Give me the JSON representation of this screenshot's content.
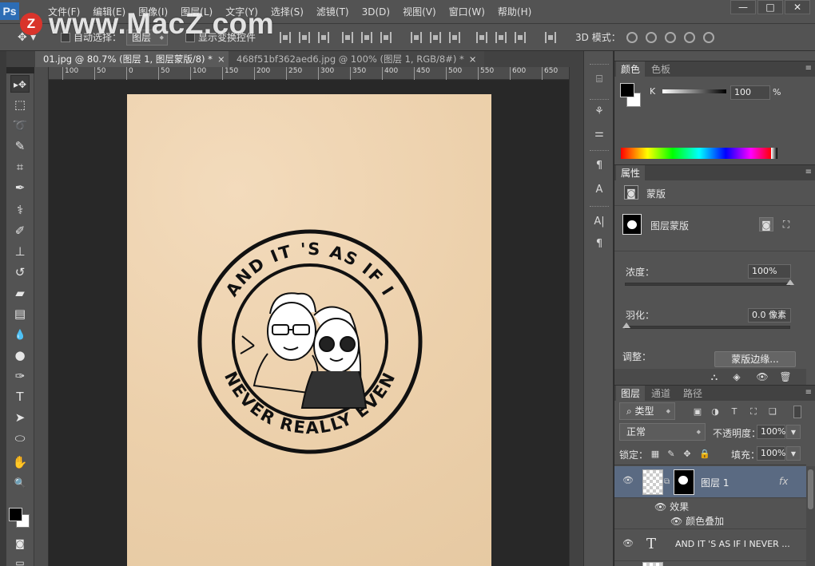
{
  "app": {
    "logo_text": "Ps",
    "watermark_text": "www.MacZ.com",
    "watermark_badge": "Z"
  },
  "menu": [
    "文件(F)",
    "编辑(E)",
    "图像(I)",
    "图层(L)",
    "文字(Y)",
    "选择(S)",
    "滤镜(T)",
    "3D(D)",
    "视图(V)",
    "窗口(W)",
    "帮助(H)"
  ],
  "window_controls": {
    "minimize": "—",
    "maximize": "□",
    "close": "✕"
  },
  "options": {
    "auto_select_label": "自动选择：",
    "auto_select_target": "图层",
    "show_transform_label": "显示变换控件",
    "mode_3d_label": "3D 模式："
  },
  "tabs": [
    {
      "label": "01.jpg @ 80.7% (图层 1, 图层蒙版/8) *",
      "close": "×"
    },
    {
      "label": "468f51bf362aed6.jpg @ 100% (图层 1, RGB/8#) *",
      "close": "×"
    }
  ],
  "ruler_ticks": [
    "100",
    "50",
    "0",
    "50",
    "100",
    "150",
    "200",
    "250",
    "300",
    "350",
    "400",
    "450",
    "500",
    "550",
    "600",
    "650"
  ],
  "tools": [
    {
      "name": "move-tool",
      "glyph": "▸✥"
    },
    {
      "name": "marquee-tool",
      "glyph": "⬚"
    },
    {
      "name": "lasso-tool",
      "glyph": "➰"
    },
    {
      "name": "quick-select-tool",
      "glyph": "✎"
    },
    {
      "name": "crop-tool",
      "glyph": "⌗"
    },
    {
      "name": "eyedropper-tool",
      "glyph": "✒"
    },
    {
      "name": "healing-tool",
      "glyph": "⚕"
    },
    {
      "name": "brush-tool",
      "glyph": "✐"
    },
    {
      "name": "stamp-tool",
      "glyph": "⊥"
    },
    {
      "name": "history-brush-tool",
      "glyph": "↺"
    },
    {
      "name": "eraser-tool",
      "glyph": "▰"
    },
    {
      "name": "gradient-tool",
      "glyph": "▤"
    },
    {
      "name": "blur-tool",
      "glyph": "💧"
    },
    {
      "name": "dodge-tool",
      "glyph": "●"
    },
    {
      "name": "pen-tool",
      "glyph": "✑"
    },
    {
      "name": "type-tool",
      "glyph": "T"
    },
    {
      "name": "path-select-tool",
      "glyph": "➤"
    },
    {
      "name": "shape-tool",
      "glyph": "⬭"
    },
    {
      "name": "hand-tool",
      "glyph": "✋"
    },
    {
      "name": "zoom-tool",
      "glyph": "🔍"
    }
  ],
  "stamp": {
    "top_text": "AND IT 'S AS IF I",
    "bottom_text": "NEVER REALLY EVEN"
  },
  "color_panel": {
    "tab_active": "颜色",
    "tab_inactive": "色板",
    "channel_label": "K",
    "channel_value": "100",
    "channel_unit": "%"
  },
  "properties_panel": {
    "tab": "属性",
    "section_label": "蒙版",
    "mask_label": "图层蒙版",
    "density_label": "浓度：",
    "density_value": "100%",
    "feather_label": "羽化：",
    "feather_value": "0.0 像素",
    "adjust_label": "调整：",
    "refine_button": "蒙版边缘..."
  },
  "layers_panel": {
    "tabs": [
      "图层",
      "通道",
      "路径"
    ],
    "filter_label": "类型",
    "blend_mode": "正常",
    "opacity_label": "不透明度：",
    "opacity_value": "100%",
    "lock_label": "锁定：",
    "fill_label": "填充：",
    "fill_value": "100%",
    "layers": [
      {
        "name": "图层 1",
        "fx": "fx"
      },
      {
        "name": "AND IT 'S AS IF I NEVER ..."
      }
    ],
    "effects_label": "效果",
    "effect_item": "颜色叠加"
  }
}
